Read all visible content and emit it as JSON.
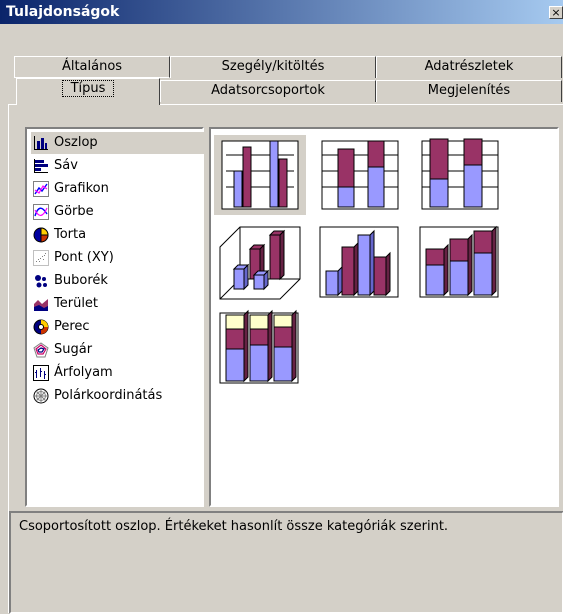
{
  "window": {
    "title": "Tulajdonságok",
    "close_glyph": "×"
  },
  "tabs_row1": [
    "Általános",
    "Szegély/kitöltés",
    "Adatrészletek"
  ],
  "tabs_row2": [
    "Típus",
    "Adatsorcsoportok",
    "Megjelenítés"
  ],
  "active_tab": "Típus",
  "chart_types": [
    {
      "label": "Oszlop",
      "icon": "column-chart-icon",
      "selected": true
    },
    {
      "label": "Sáv",
      "icon": "bar-chart-icon",
      "selected": false
    },
    {
      "label": "Grafikon",
      "icon": "line-chart-icon",
      "selected": false
    },
    {
      "label": "Görbe",
      "icon": "smooth-line-chart-icon",
      "selected": false
    },
    {
      "label": "Torta",
      "icon": "pie-chart-icon",
      "selected": false
    },
    {
      "label": "Pont (XY)",
      "icon": "scatter-chart-icon",
      "selected": false
    },
    {
      "label": "Buborék",
      "icon": "bubble-chart-icon",
      "selected": false
    },
    {
      "label": "Terület",
      "icon": "area-chart-icon",
      "selected": false
    },
    {
      "label": "Perec",
      "icon": "doughnut-chart-icon",
      "selected": false
    },
    {
      "label": "Sugár",
      "icon": "radar-chart-icon",
      "selected": false
    },
    {
      "label": "Árfolyam",
      "icon": "stock-chart-icon",
      "selected": false
    },
    {
      "label": "Polárkoordinátás",
      "icon": "polar-chart-icon",
      "selected": false
    }
  ],
  "subtypes": [
    {
      "name": "clustered-column",
      "selected": true
    },
    {
      "name": "stacked-column",
      "selected": false
    },
    {
      "name": "100-percent-stacked-column",
      "selected": false
    },
    {
      "name": "3d-clustered-column",
      "selected": false
    },
    {
      "name": "3d-column",
      "selected": false
    },
    {
      "name": "3d-stacked-column",
      "selected": false
    },
    {
      "name": "3d-100-percent-stacked-column",
      "selected": false
    }
  ],
  "description": "Csoportosított oszlop. Értékeket hasonlít össze kategóriák szerint.",
  "colors": {
    "title_bar_start": "#0a246a",
    "title_bar_end": "#a6caf0",
    "face": "#d4d0c8",
    "series_blue": "#9999ff",
    "series_maroon": "#993366",
    "series_cream": "#ffffcc"
  }
}
